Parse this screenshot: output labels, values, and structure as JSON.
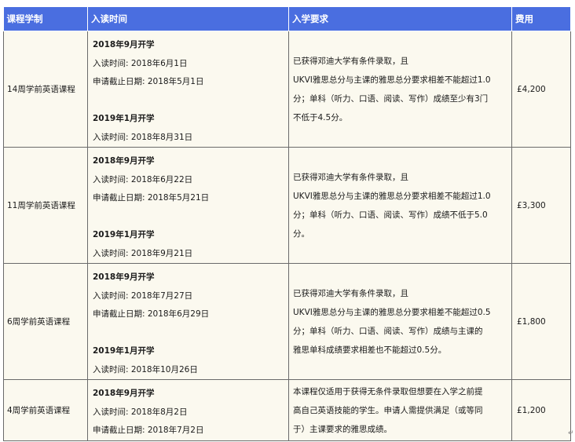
{
  "headers": [
    "课程学制",
    "入读时间",
    "入学要求",
    "费用"
  ],
  "rows": [
    {
      "name": "14周学前英语课程",
      "intake1_title": "2018年9月开学",
      "intake1_start": "入读时间: 2018年6月1日",
      "intake1_deadline": "申请截止日期:  2018年5月1日",
      "intake2_title": "2019年1月开学",
      "intake2_start": "入读时间:  2018年8月31日",
      "req": [
        "已获得邓迪大学有条件录取，且",
        "UKVI雅思总分与主课的雅思总分要求相差不能超过1.0",
        "分；单科（听力、口语、阅读、写作）成绩至少有3门",
        "不低于4.5分。"
      ],
      "fee": "£4,200"
    },
    {
      "name": "11周学前英语课程",
      "intake1_title": "2018年9月开学",
      "intake1_start": "入读时间: 2018年6月22日",
      "intake1_deadline": "申请截止日期:  2018年5月21日",
      "intake2_title": "2019年1月开学",
      "intake2_start": "入读时间:  2018年9月21日",
      "req": [
        "已获得邓迪大学有条件录取，且",
        "UKVI雅思总分与主课的雅思总分要求相差不能超过1.0",
        "分；单科（听力、口语、阅读、写作）成绩不低于5.0",
        "分。"
      ],
      "fee": "£3,300"
    },
    {
      "name": "6周学前英语课程",
      "intake1_title": "2018年9月开学",
      "intake1_start": "入读时间: 2018年7月27日",
      "intake1_deadline": "申请截止日期:  2018年6月29日",
      "intake2_title": "2019年1月开学",
      "intake2_start": "入读时间:  2018年10月26日",
      "req": [
        "已获得邓迪大学有条件录取，且",
        "UKVI雅思总分与主课的雅思总分要求相差不能超过0.5",
        "分；单科（听力、口语、阅读、写作）成绩与主课的",
        "雅思单科成绩要求相差也不能超过0.5分。"
      ],
      "fee": "£1,800"
    },
    {
      "name": "4周学前英语课程",
      "intake1_title": "2018年9月开学",
      "intake1_start": "入读时间: 2018年8月2日",
      "intake1_deadline": "申请截止日期:  2018年7月2日",
      "req": [
        "本课程仅适用于获得无条件录取但想要在入学之前提",
        "高自己英语技能的学生。申请人需提供满足（或等同",
        "于）主课要求的雅思成绩。"
      ],
      "fee": "£1,200"
    }
  ],
  "paragraph_mark": "↵"
}
